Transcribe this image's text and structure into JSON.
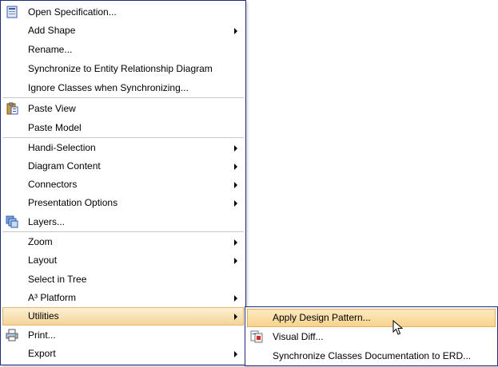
{
  "main_menu": {
    "items": [
      {
        "label": "Open Specification...",
        "icon": "specification-icon",
        "submenu": false
      },
      {
        "label": "Add Shape",
        "submenu": true
      },
      {
        "label": "Rename...",
        "submenu": false
      },
      {
        "label": "Synchronize to Entity Relationship Diagram",
        "submenu": false
      },
      {
        "label": "Ignore Classes when Synchronizing...",
        "submenu": false
      },
      {
        "label": "Paste View",
        "icon": "paste-icon",
        "submenu": false
      },
      {
        "label": "Paste Model",
        "submenu": false
      },
      {
        "label": "Handi-Selection",
        "submenu": true
      },
      {
        "label": "Diagram Content",
        "submenu": true
      },
      {
        "label": "Connectors",
        "submenu": true
      },
      {
        "label": "Presentation Options",
        "submenu": true
      },
      {
        "label": "Layers...",
        "icon": "layers-icon",
        "submenu": false
      },
      {
        "label": "Zoom",
        "submenu": true
      },
      {
        "label": "Layout",
        "submenu": true
      },
      {
        "label": "Select in Tree",
        "submenu": false
      },
      {
        "label": "A³ Platform",
        "submenu": true
      },
      {
        "label": "Utilities",
        "submenu": true,
        "highlighted": true
      },
      {
        "label": "Print...",
        "icon": "print-icon",
        "submenu": false
      },
      {
        "label": "Export",
        "submenu": true
      }
    ]
  },
  "sub_menu": {
    "items": [
      {
        "label": "Apply Design Pattern...",
        "highlighted": true
      },
      {
        "label": "Visual Diff...",
        "icon": "visual-diff-icon"
      },
      {
        "label": "Synchronize Classes Documentation to ERD..."
      }
    ]
  },
  "colors": {
    "border": "#1c2d7a",
    "highlight": "#f7d38e",
    "separator": "#c9c9c9"
  }
}
